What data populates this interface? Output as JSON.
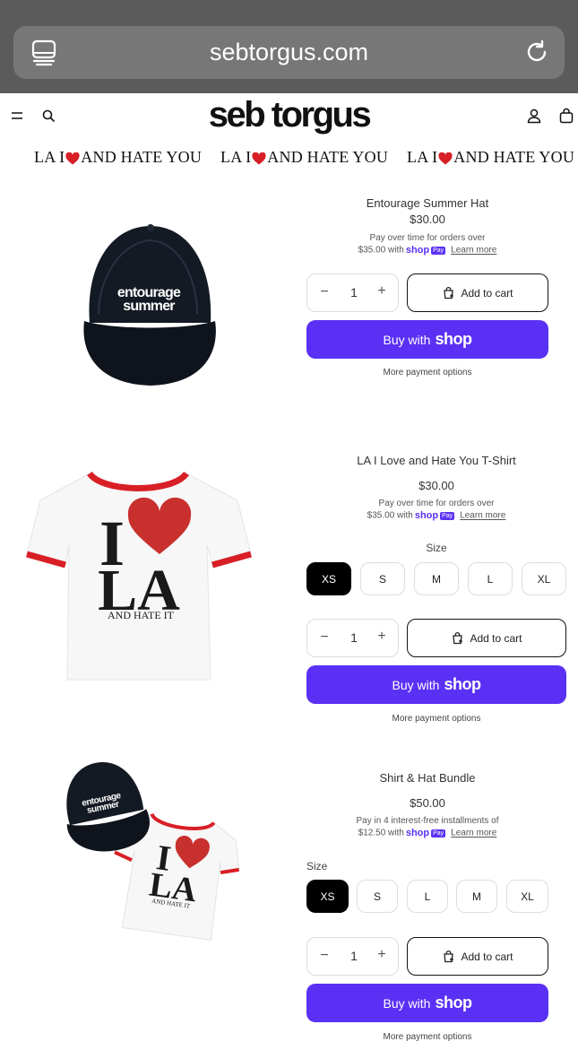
{
  "browser": {
    "url": "sebtorgus.com"
  },
  "header": {
    "logo": "seb torgus"
  },
  "marquee": {
    "before_heart": "LA I",
    "after_heart": "AND HATE YOU"
  },
  "products": [
    {
      "title": "Entourage Summer Hat",
      "price": "$30.00",
      "pay_line1": "Pay over time for orders over",
      "pay_amount": "$35.00 with",
      "shop": "shop",
      "pay": "Pay",
      "learn_more": "Learn more",
      "qty": "1",
      "add_to_cart": "Add to cart",
      "buy_with": "Buy with",
      "more_options": "More payment options",
      "image_text": [
        "entourage",
        "summer"
      ]
    },
    {
      "title": "LA I Love and Hate You T-Shirt",
      "price": "$30.00",
      "pay_line1": "Pay over time for orders over",
      "pay_amount": "$35.00 with",
      "shop": "shop",
      "pay": "Pay",
      "learn_more": "Learn more",
      "size_label": "Size",
      "sizes": [
        "XS",
        "S",
        "M",
        "L",
        "XL"
      ],
      "selected_size": "XS",
      "qty": "1",
      "add_to_cart": "Add to cart",
      "buy_with": "Buy with",
      "more_options": "More payment options",
      "image_text": [
        "I",
        "LA",
        "AND HATE IT"
      ]
    },
    {
      "title": "Shirt & Hat Bundle",
      "price": "$50.00",
      "pay_line1": "Pay in 4 interest-free installments of",
      "pay_amount": "$12.50 with",
      "shop": "shop",
      "pay": "Pay",
      "learn_more": "Learn more",
      "size_label": "Size",
      "sizes": [
        "XS",
        "S",
        "L",
        "M",
        "XL"
      ],
      "selected_size": "XS",
      "qty": "1",
      "add_to_cart": "Add to cart",
      "buy_with": "Buy with",
      "more_options": "More payment options",
      "image_text": [
        "entourage",
        "summer",
        "I",
        "LA",
        "AND HATE IT"
      ]
    }
  ],
  "colors": {
    "shop_purple": "#5a31f4",
    "heart_red": "#d81f26",
    "chrome_gray": "#5b5b5b"
  }
}
